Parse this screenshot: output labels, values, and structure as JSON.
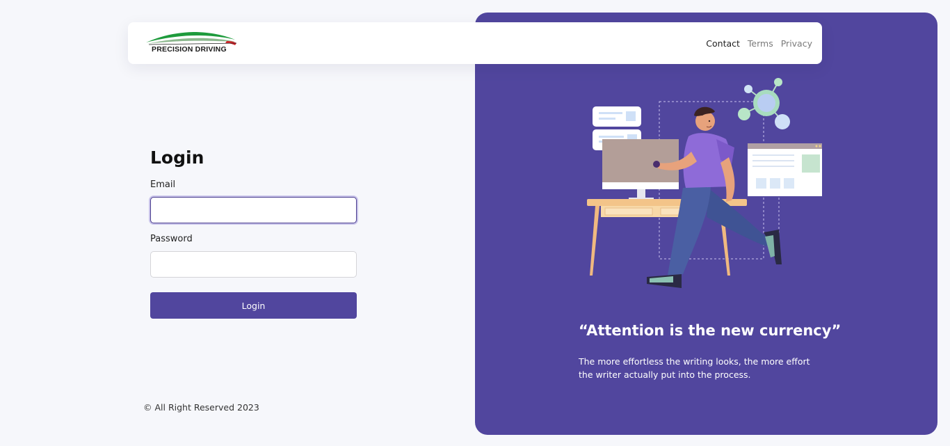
{
  "brand": {
    "name": "PRECISION DRIVING",
    "swoosh_color": "#1e9b3c",
    "accent_color": "#d6262b"
  },
  "nav": {
    "links": [
      {
        "label": "Contact",
        "active": true
      },
      {
        "label": "Terms",
        "active": false
      },
      {
        "label": "Privacy",
        "active": false
      }
    ]
  },
  "login": {
    "title": "Login",
    "email_label": "Email",
    "email_value": "",
    "password_label": "Password",
    "password_value": "",
    "submit_label": "Login"
  },
  "footer": {
    "copyright": "© All Right Reserved 2023"
  },
  "hero": {
    "quote_title": "“Attention is the new currency”",
    "quote_body": "The more effortless the writing looks, the more effort the writer actually put into the process.",
    "illustration_icon": "person-at-desk-illustration"
  },
  "colors": {
    "primary": "#51469e",
    "background": "#f6f7fb"
  }
}
